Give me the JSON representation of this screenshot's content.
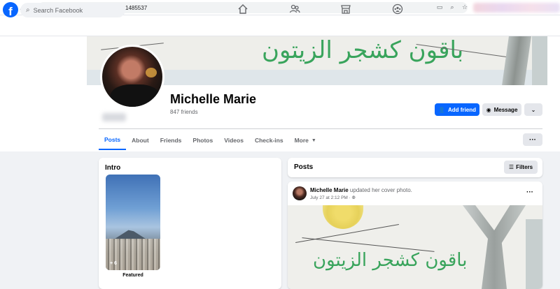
{
  "browser": {
    "url": "facebook.com/michelle.marie.1485537"
  },
  "fb": {
    "logo_letter": "f",
    "search_placeholder": "Search Facebook"
  },
  "profile": {
    "name": "Michelle Marie",
    "friends": "847 friends",
    "add_friend": "Add friend",
    "message": "Message"
  },
  "tabs": [
    "Posts",
    "About",
    "Friends",
    "Photos",
    "Videos",
    "Check-ins",
    "More"
  ],
  "cover": {
    "arabic_text": "باقون كشجر الزيتون"
  },
  "intro": {
    "title": "Intro",
    "featured_count": "+ 6",
    "featured_label": "Featured"
  },
  "posts": {
    "title": "Posts",
    "filters": "Filters",
    "post": {
      "author": "Michelle Marie",
      "action": "updated her cover photo.",
      "time": "July 27 at 2:12 PM · "
    }
  },
  "colors": {
    "brand": "#0866ff",
    "page_bg": "#f0f2f5",
    "button_gray": "#e4e6eb"
  }
}
